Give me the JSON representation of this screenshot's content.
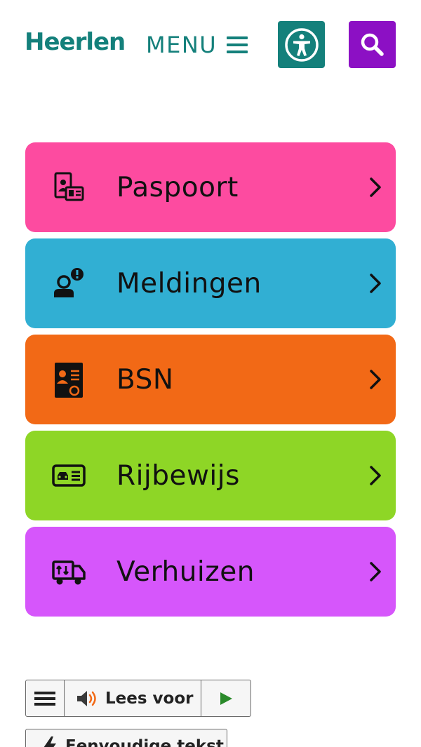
{
  "header": {
    "logo": "Heerlen",
    "menu_label": "MENU",
    "accessibility_color": "#14807b",
    "search_color": "#8c10c4"
  },
  "tiles": [
    {
      "label": "Paspoort",
      "color": "#fd4ba0",
      "icon": "passport-icon"
    },
    {
      "label": "Meldingen",
      "color": "#31afd3",
      "icon": "report-person-icon"
    },
    {
      "label": "BSN",
      "color": "#f26916",
      "icon": "certificate-id-icon"
    },
    {
      "label": "Rijbewijs",
      "color": "#8ed626",
      "icon": "driving-license-icon"
    },
    {
      "label": "Verhuizen",
      "color": "#d656fb",
      "icon": "moving-truck-icon"
    }
  ],
  "readbar": {
    "read_label": "Lees voor",
    "simple_label": "Eenvoudige tekst"
  }
}
